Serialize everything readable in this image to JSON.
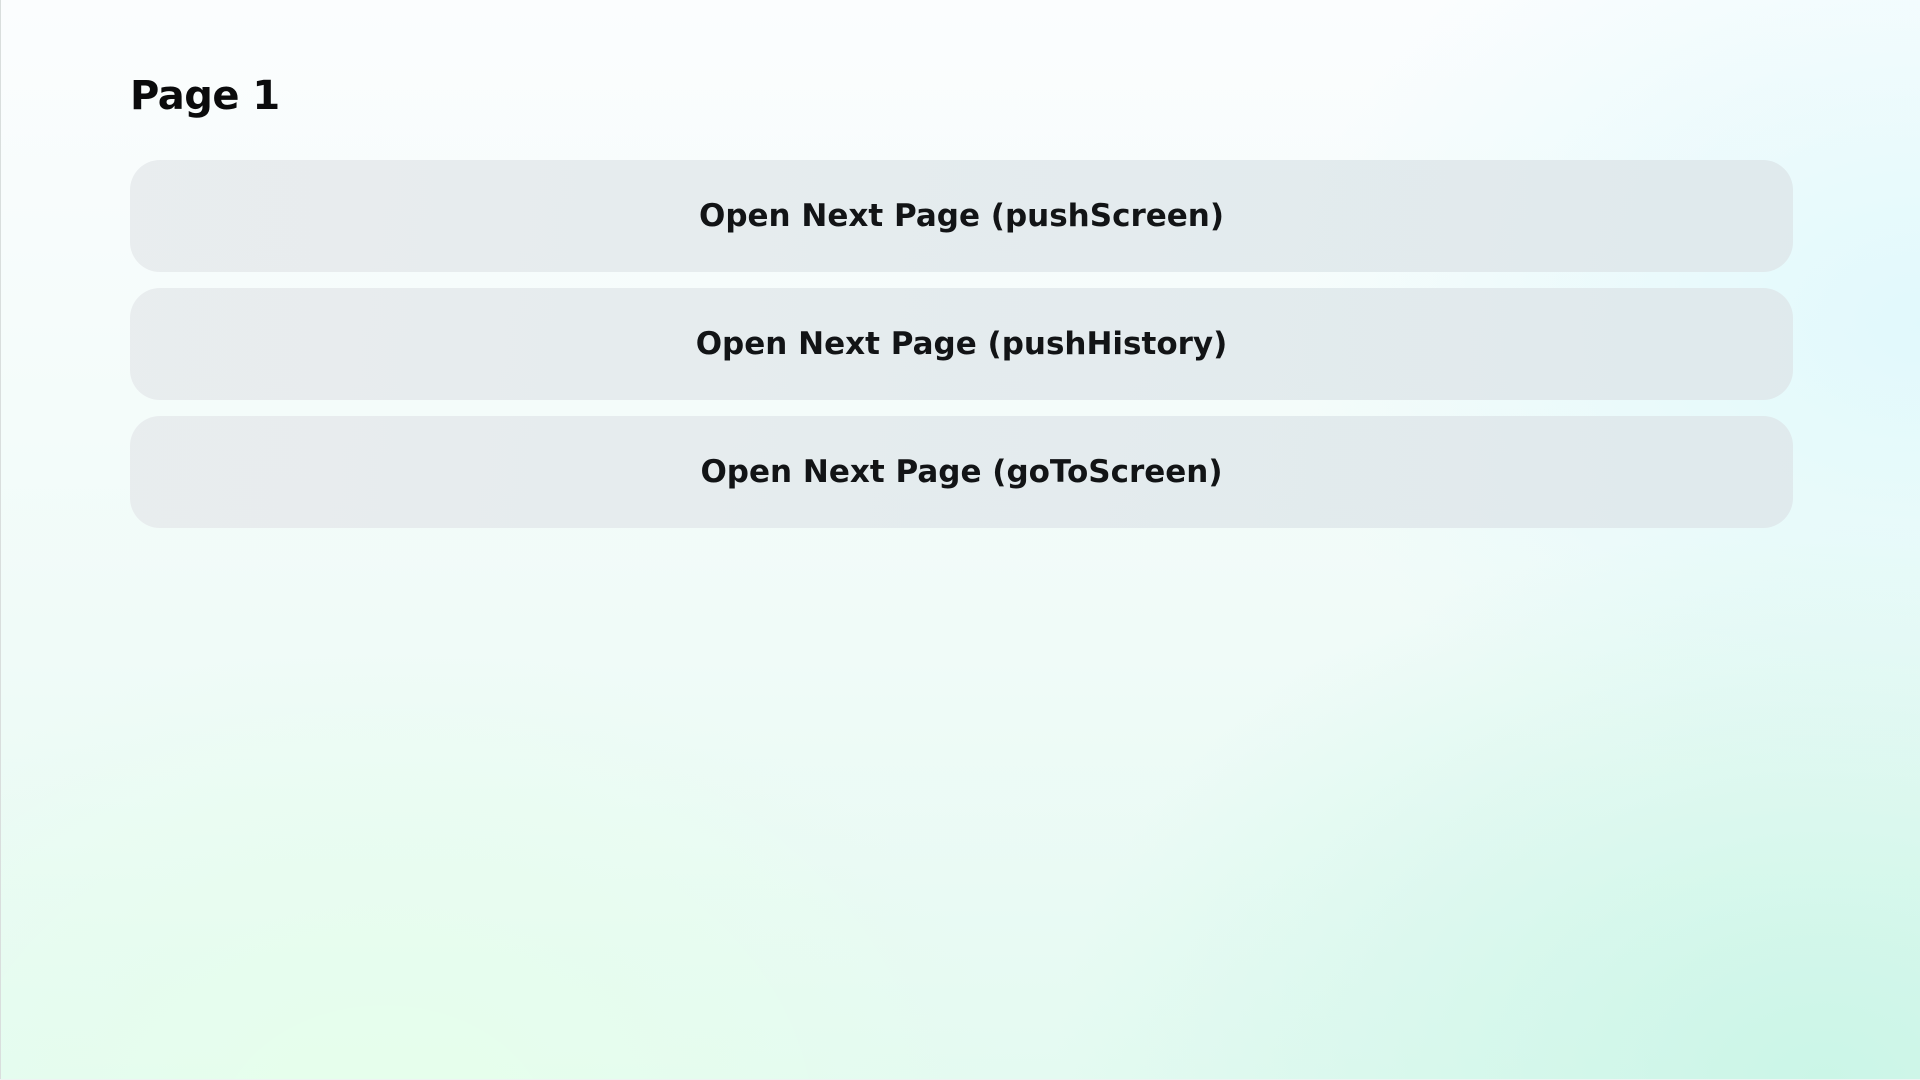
{
  "page": {
    "title": "Page 1"
  },
  "buttons": [
    {
      "label": "Open Next Page (pushScreen)"
    },
    {
      "label": "Open Next Page (pushHistory)"
    },
    {
      "label": "Open Next Page (goToScreen)"
    }
  ]
}
